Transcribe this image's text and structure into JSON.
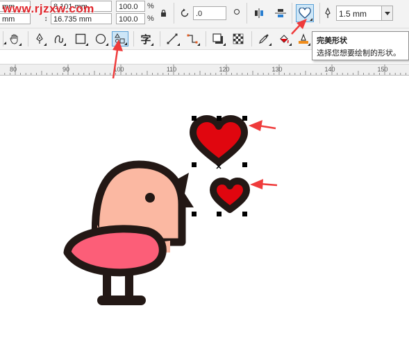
{
  "watermark": "www.rjzxw.com",
  "propbar": {
    "x_value": "8.101 mm",
    "y_value": "16.735 mm",
    "unit_left": "mm",
    "scale_w": "100.0",
    "scale_h": "100.0",
    "pct_symbol": "%",
    "rotation": ".0",
    "outline_width": "1.5 mm"
  },
  "tooltip": {
    "title": "完美形状",
    "description": "选择您想要绘制的形状。"
  },
  "toolbox": {
    "text_tool": "字"
  },
  "ruler": {
    "labels": [
      "80",
      "90",
      "100",
      "110",
      "120",
      "130",
      "140",
      "150"
    ]
  },
  "colors": {
    "accent_red": "#ef3b3b",
    "heart_fill": "#e0060f",
    "outline": "#231815",
    "bird_head": "#fbb8a2",
    "bird_wing": "#fc5e78",
    "tool_highlight": "#cde6f7"
  },
  "icons": [
    "pan-icon",
    "pen-icon",
    "freehand-icon",
    "rectangle-icon",
    "ellipse-icon",
    "perfect-shape-icon",
    "text-icon",
    "line-icon",
    "connector-icon",
    "drop-shadow-icon",
    "transparency-icon",
    "eyedropper-icon",
    "fill-icon",
    "smart-fill-icon",
    "heart-shape-icon",
    "outline-pen-icon"
  ]
}
